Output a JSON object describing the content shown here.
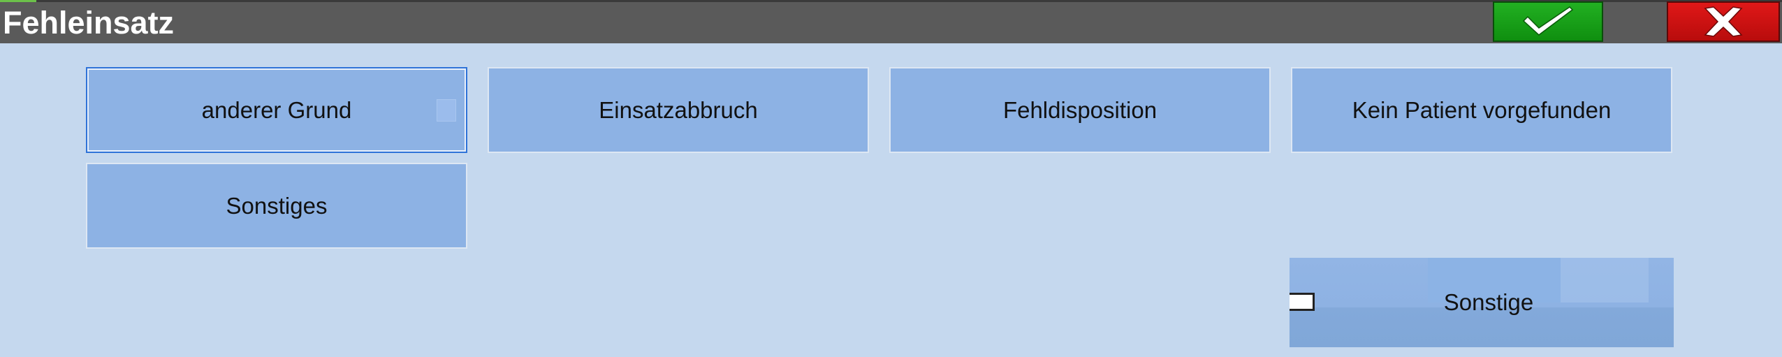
{
  "window": {
    "title": "Fehleinsatz"
  },
  "actions": {
    "ok_icon": "checkmark-icon",
    "cancel_icon": "x-icon",
    "ok_color": "#1aa01a",
    "cancel_color": "#d01010"
  },
  "reasons": [
    {
      "label": "anderer Grund",
      "selected": true
    },
    {
      "label": "Einsatzabbruch",
      "selected": false
    },
    {
      "label": "Fehldisposition",
      "selected": false
    },
    {
      "label": "Kein Patient vorgefunden",
      "selected": false
    },
    {
      "label": "Sonstiges",
      "selected": false
    }
  ],
  "sonstige": {
    "label": "Sonstige",
    "checked": false
  },
  "colors": {
    "background": "#c5d8ee",
    "titlebar": "#5a5a5a",
    "button": "#8db2e4",
    "selected_border": "#2f73d8"
  }
}
